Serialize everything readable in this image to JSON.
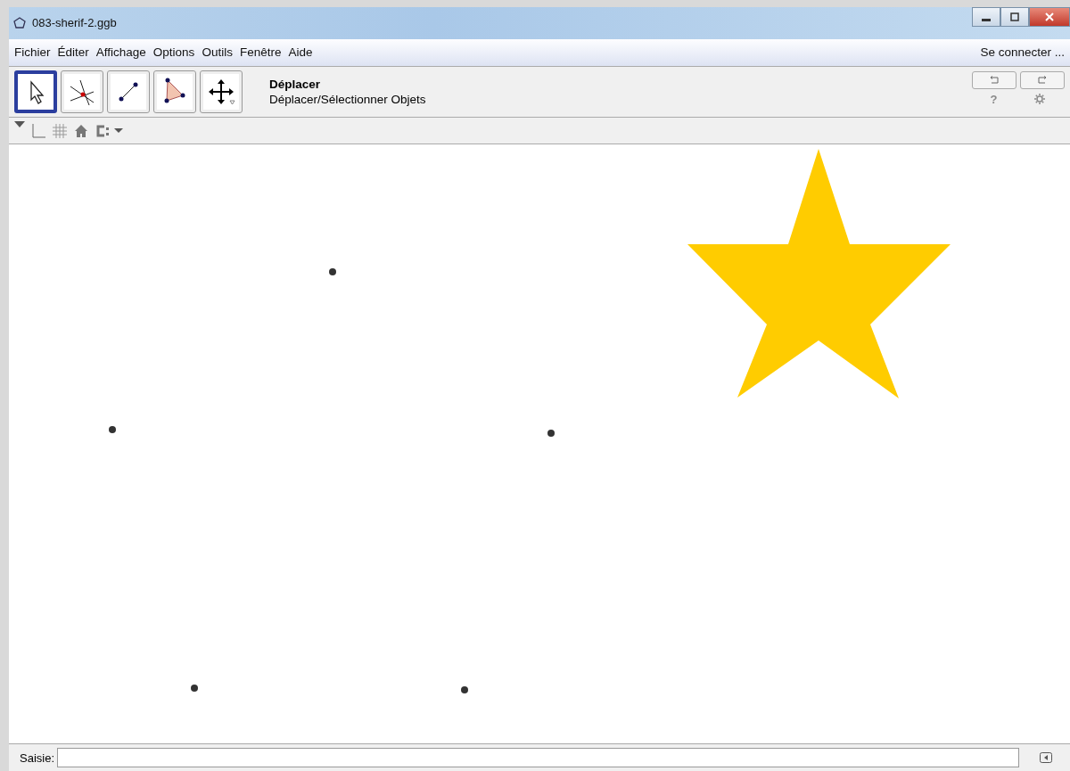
{
  "window": {
    "title": "083-sherif-2.ggb"
  },
  "menu": [
    "Fichier",
    "Éditer",
    "Affichage",
    "Options",
    "Outils",
    "Fenêtre",
    "Aide"
  ],
  "sign_in": "Se connecter ...",
  "tools": [
    {
      "kind": "move",
      "selected": true
    },
    {
      "kind": "intersect",
      "selected": false
    },
    {
      "kind": "segment",
      "selected": false
    },
    {
      "kind": "polygon",
      "selected": false
    },
    {
      "kind": "pan",
      "selected": false
    }
  ],
  "tool_info": {
    "name": "Déplacer",
    "description": "Déplacer/Sélectionner Objets"
  },
  "help": "?",
  "input_bar": {
    "label": "Saisie:"
  }
}
